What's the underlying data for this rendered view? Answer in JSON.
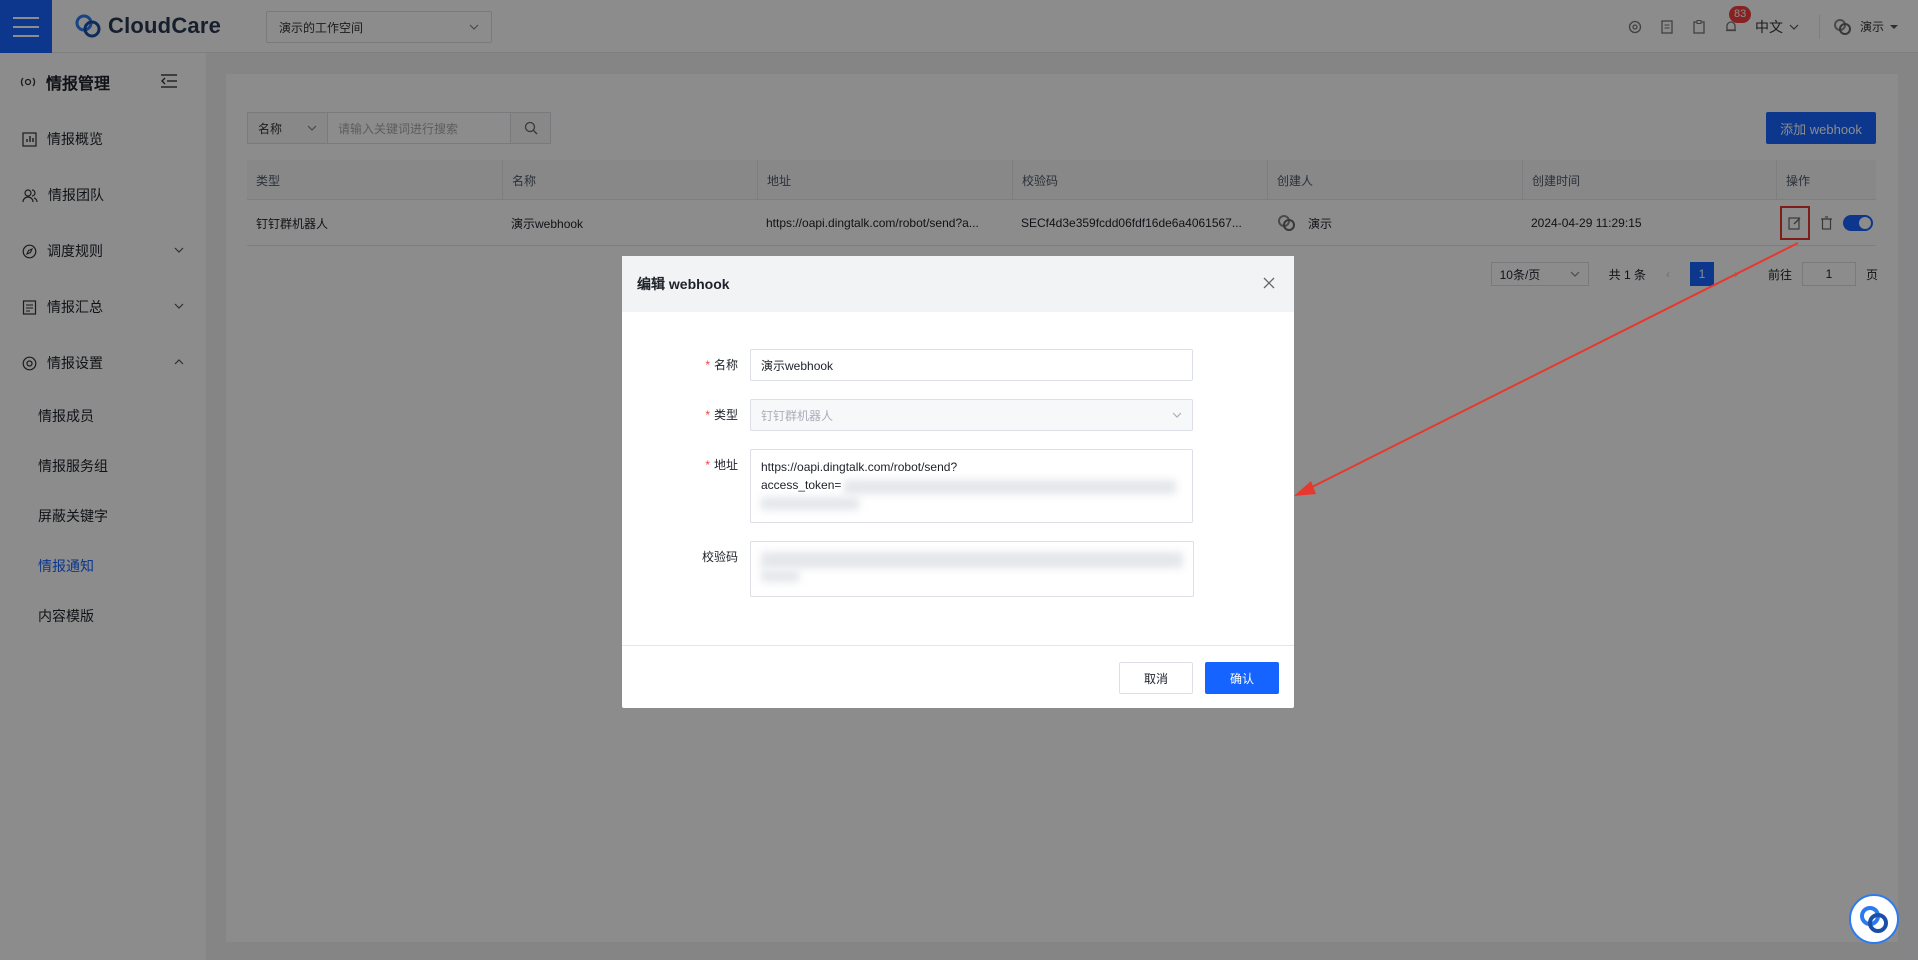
{
  "app": {
    "brand": "CloudCare",
    "workspace": "演示的工作空间"
  },
  "topbar": {
    "notification_count": "83",
    "language": "中文",
    "user_name": "演示"
  },
  "sidebar": {
    "title": "情报管理",
    "items": [
      {
        "label": "情报概览"
      },
      {
        "label": "情报团队"
      },
      {
        "label": "调度规则"
      },
      {
        "label": "情报汇总"
      },
      {
        "label": "情报设置"
      }
    ],
    "sub_items": [
      {
        "label": "情报成员"
      },
      {
        "label": "情报服务组"
      },
      {
        "label": "屏蔽关键字"
      },
      {
        "label": "情报通知"
      },
      {
        "label": "内容模版"
      }
    ]
  },
  "filter": {
    "field": "名称",
    "placeholder": "请输入关键词进行搜索"
  },
  "actions": {
    "add_label": "添加 webhook"
  },
  "table": {
    "columns": [
      "类型",
      "名称",
      "地址",
      "校验码",
      "创建人",
      "创建时间",
      "操作"
    ],
    "rows": [
      {
        "type": "钉钉群机器人",
        "name": "演示webhook",
        "address": "https://oapi.dingtalk.com/robot/send?a...",
        "secret": "SECf4d3e359fcdd06fdf16de6a4061567...",
        "creator": "演示",
        "created_at": "2024-04-29 11:29:15",
        "enabled": true
      }
    ]
  },
  "pagination": {
    "page_size": "10条/页",
    "total": "共 1 条",
    "current": "1",
    "goto_label": "前往",
    "goto_value": "1",
    "page_suffix": "页"
  },
  "modal": {
    "title": "编辑 webhook",
    "name_label": "名称",
    "name_value": "演示webhook",
    "type_label": "类型",
    "type_value": "钉钉群机器人",
    "address_label": "地址",
    "address_line1": "https://oapi.dingtalk.com/robot/send?",
    "address_line2": "access_token=",
    "secret_label": "校验码",
    "cancel_label": "取消",
    "confirm_label": "确认"
  },
  "colors": {
    "primary": "#1664ff",
    "annotation": "#e8372c",
    "danger": "#f53f3f"
  }
}
